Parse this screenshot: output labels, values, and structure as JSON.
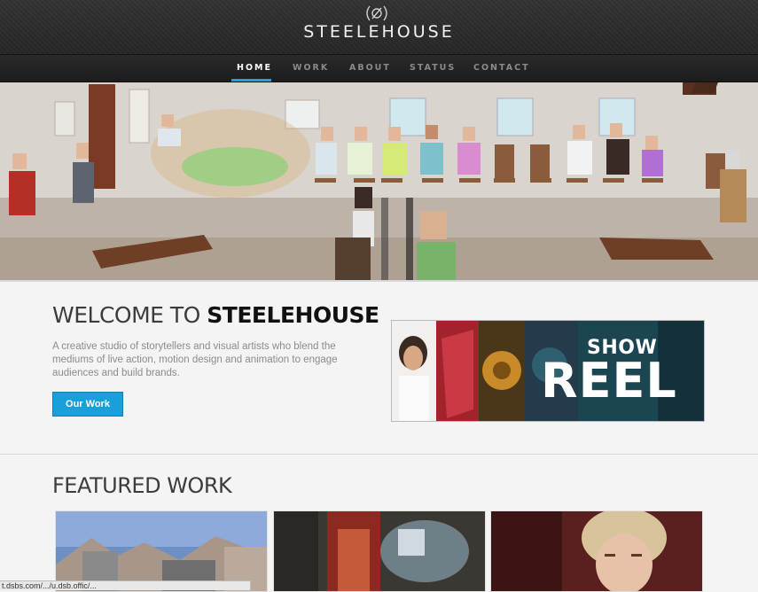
{
  "brand": {
    "name": "STEELEHOUSE",
    "accent": "#1ca3dd"
  },
  "nav": {
    "items": [
      {
        "label": "HOME",
        "active": true
      },
      {
        "label": "WORK",
        "active": false
      },
      {
        "label": "ABOUT",
        "active": false
      },
      {
        "label": "STATUS",
        "active": false
      },
      {
        "label": "CONTACT",
        "active": false
      }
    ]
  },
  "welcome": {
    "title_prefix": "WELCOME TO ",
    "title_strong": "STEELEHOUSE",
    "description": "A creative studio of storytellers and visual artists who blend the mediums of live action, motion design and animation to engage audiences and build brands.",
    "button_label": "Our Work"
  },
  "showreel": {
    "line1": "SHOW",
    "line2": "REEL"
  },
  "featured": {
    "title": "FEATURED WORK"
  },
  "status_bar": {
    "text": "t.dsbs.com/.../u.dsb.offic/..."
  }
}
